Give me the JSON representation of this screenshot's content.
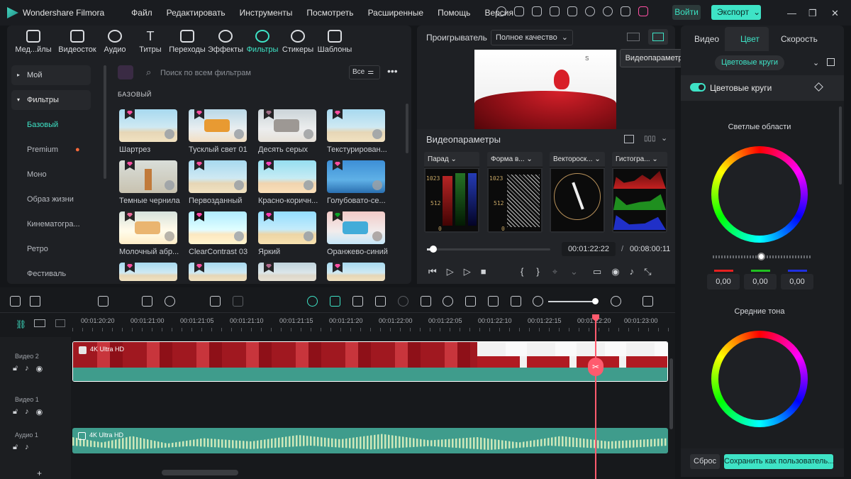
{
  "app": {
    "title": "Wondershare Filmora"
  },
  "menu": [
    "Файл",
    "Редактировать",
    "Инструменты",
    "Посмотреть",
    "Расширенные",
    "Помощь",
    "Версия"
  ],
  "header": {
    "login": "Войти",
    "export": "Экспорт"
  },
  "toolbar": [
    "Мед...йлы",
    "Видеосток",
    "Аудио",
    "Титры",
    "Переходы",
    "Эффекты",
    "Фильтры",
    "Стикеры",
    "Шаблоны"
  ],
  "sidebar": {
    "items": [
      "Мой",
      "Фильтры",
      "Базовый",
      "Premium",
      "Моно",
      "Образ жизни",
      "Кинематогра...",
      "Ретро",
      "Фестиваль"
    ]
  },
  "browser": {
    "search_placeholder": "Поиск по всем фильтрам",
    "filter_btn": "Все",
    "section": "БАЗОВЫЙ",
    "filters": [
      "Шартрез",
      "Тусклый свет 01",
      "Десять серых",
      "Текстурирован...",
      "Темные чернила",
      "Первозданный",
      "Красно-коричн...",
      "Голубовато-се...",
      "Молочный абр...",
      "ClearContrast 03",
      "Яркий",
      "Оранжево-синий"
    ]
  },
  "player": {
    "label": "Проигрыватель",
    "quality": "Полное качество",
    "tooltip": "Видеопараметры",
    "scope_title": "Видеопараметры",
    "scopes": [
      "Парад",
      "Форма в...",
      "Вектороск...",
      "Гистогра..."
    ],
    "scope_ticks": [
      "1023",
      "512",
      "0"
    ],
    "current_time": "00:01:22:22",
    "separator": "/",
    "total_time": "00:08:00:11",
    "progress": 0.05
  },
  "timeline": {
    "ruler": [
      "00:01:20:20",
      "00:01:21:00",
      "00:01:21:05",
      "00:01:21:10",
      "00:01:21:15",
      "00:01:21:20",
      "00:01:22:00",
      "00:01:22:05",
      "00:01:22:10",
      "00:01:22:15",
      "00:01:22:20",
      "00:01:23:00"
    ],
    "tracks": [
      "Видео 2",
      "Видео 1",
      "Аудио 1"
    ],
    "clip_video": "4K Ultra HD",
    "clip_audio": "4K Ultra HD",
    "add": "+"
  },
  "right": {
    "tabs": [
      "Видео",
      "Цвет",
      "Скорость"
    ],
    "sub_tab": "Цветовые круги",
    "toggle_label": "Цветовые круги",
    "wheel1": "Светлые области",
    "wheel2": "Средние тона",
    "values": [
      "0,00",
      "0,00",
      "0,00"
    ],
    "reset": "Сброс",
    "save": "Сохранить как пользователь..."
  },
  "colors": {
    "accent": "#3ee3c6",
    "playhead": "#ff5b6e",
    "clip": "#3f9c8c"
  }
}
